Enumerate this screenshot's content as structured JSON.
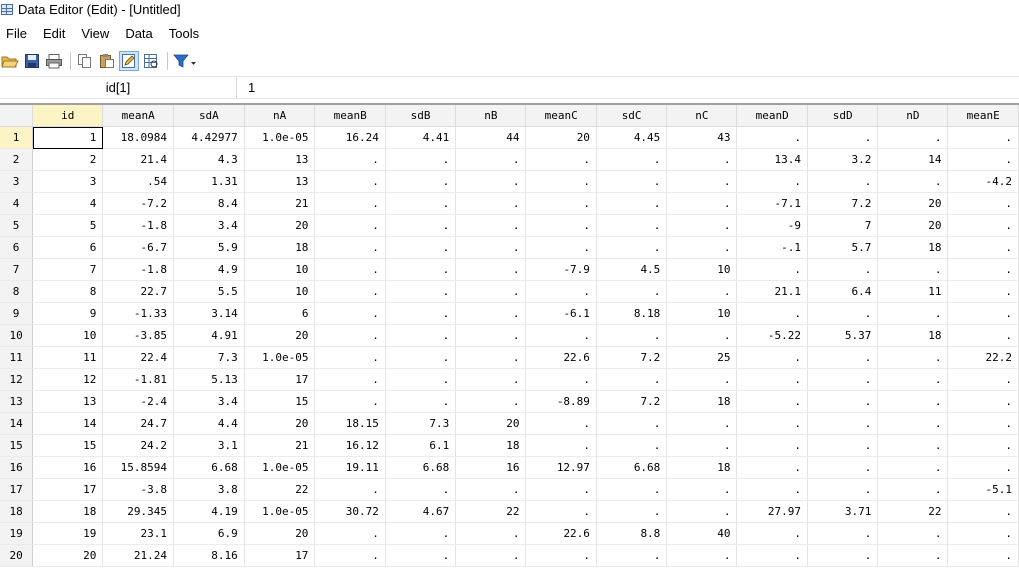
{
  "window": {
    "title": "Data Editor (Edit) - [Untitled]"
  },
  "menu": {
    "items": [
      "File",
      "Edit",
      "View",
      "Data",
      "Tools"
    ]
  },
  "toolbar": {
    "buttons": [
      "open-icon",
      "save-icon",
      "print-icon",
      "copy-icon",
      "paste-icon",
      "edit-mode-icon",
      "browse-mode-icon",
      "filter-icon"
    ]
  },
  "cellbar": {
    "ref": "id[1]",
    "value": "1"
  },
  "grid": {
    "columns": [
      "id",
      "meanA",
      "sdA",
      "nA",
      "meanB",
      "sdB",
      "nB",
      "meanC",
      "sdC",
      "nC",
      "meanD",
      "sdD",
      "nD",
      "meanE"
    ],
    "rows": [
      [
        "1",
        "18.0984",
        "4.42977",
        "1.0e-05",
        "16.24",
        "4.41",
        "44",
        "20",
        "4.45",
        "43",
        ".",
        ".",
        ".",
        "."
      ],
      [
        "2",
        "21.4",
        "4.3",
        "13",
        ".",
        ".",
        ".",
        ".",
        ".",
        ".",
        "13.4",
        "3.2",
        "14",
        "."
      ],
      [
        "3",
        ".54",
        "1.31",
        "13",
        ".",
        ".",
        ".",
        ".",
        ".",
        ".",
        ".",
        ".",
        ".",
        "-4.2"
      ],
      [
        "4",
        "-7.2",
        "8.4",
        "21",
        ".",
        ".",
        ".",
        ".",
        ".",
        ".",
        "-7.1",
        "7.2",
        "20",
        "."
      ],
      [
        "5",
        "-1.8",
        "3.4",
        "20",
        ".",
        ".",
        ".",
        ".",
        ".",
        ".",
        "-9",
        "7",
        "20",
        "."
      ],
      [
        "6",
        "-6.7",
        "5.9",
        "18",
        ".",
        ".",
        ".",
        ".",
        ".",
        ".",
        "-.1",
        "5.7",
        "18",
        "."
      ],
      [
        "7",
        "-1.8",
        "4.9",
        "10",
        ".",
        ".",
        ".",
        "-7.9",
        "4.5",
        "10",
        ".",
        ".",
        ".",
        "."
      ],
      [
        "8",
        "22.7",
        "5.5",
        "10",
        ".",
        ".",
        ".",
        ".",
        ".",
        ".",
        "21.1",
        "6.4",
        "11",
        "."
      ],
      [
        "9",
        "-1.33",
        "3.14",
        "6",
        ".",
        ".",
        ".",
        "-6.1",
        "8.18",
        "10",
        ".",
        ".",
        ".",
        "."
      ],
      [
        "10",
        "-3.85",
        "4.91",
        "20",
        ".",
        ".",
        ".",
        ".",
        ".",
        ".",
        "-5.22",
        "5.37",
        "18",
        "."
      ],
      [
        "11",
        "22.4",
        "7.3",
        "1.0e-05",
        ".",
        ".",
        ".",
        "22.6",
        "7.2",
        "25",
        ".",
        ".",
        ".",
        "22.2"
      ],
      [
        "12",
        "-1.81",
        "5.13",
        "17",
        ".",
        ".",
        ".",
        ".",
        ".",
        ".",
        ".",
        ".",
        ".",
        "."
      ],
      [
        "13",
        "-2.4",
        "3.4",
        "15",
        ".",
        ".",
        ".",
        "-8.89",
        "7.2",
        "18",
        ".",
        ".",
        ".",
        "."
      ],
      [
        "14",
        "24.7",
        "4.4",
        "20",
        "18.15",
        "7.3",
        "20",
        ".",
        ".",
        ".",
        ".",
        ".",
        ".",
        "."
      ],
      [
        "15",
        "24.2",
        "3.1",
        "21",
        "16.12",
        "6.1",
        "18",
        ".",
        ".",
        ".",
        ".",
        ".",
        ".",
        "."
      ],
      [
        "16",
        "15.8594",
        "6.68",
        "1.0e-05",
        "19.11",
        "6.68",
        "16",
        "12.97",
        "6.68",
        "18",
        ".",
        ".",
        ".",
        "."
      ],
      [
        "17",
        "-3.8",
        "3.8",
        "22",
        ".",
        ".",
        ".",
        ".",
        ".",
        ".",
        ".",
        ".",
        ".",
        "-5.1"
      ],
      [
        "18",
        "29.345",
        "4.19",
        "1.0e-05",
        "30.72",
        "4.67",
        "22",
        ".",
        ".",
        ".",
        "27.97",
        "3.71",
        "22",
        "."
      ],
      [
        "19",
        "23.1",
        "6.9",
        "20",
        ".",
        ".",
        ".",
        "22.6",
        "8.8",
        "40",
        ".",
        ".",
        ".",
        "."
      ],
      [
        "20",
        "21.24",
        "8.16",
        "17",
        ".",
        ".",
        ".",
        ".",
        ".",
        ".",
        ".",
        ".",
        ".",
        "."
      ]
    ],
    "selected_row": 1,
    "selected_column": "id"
  }
}
